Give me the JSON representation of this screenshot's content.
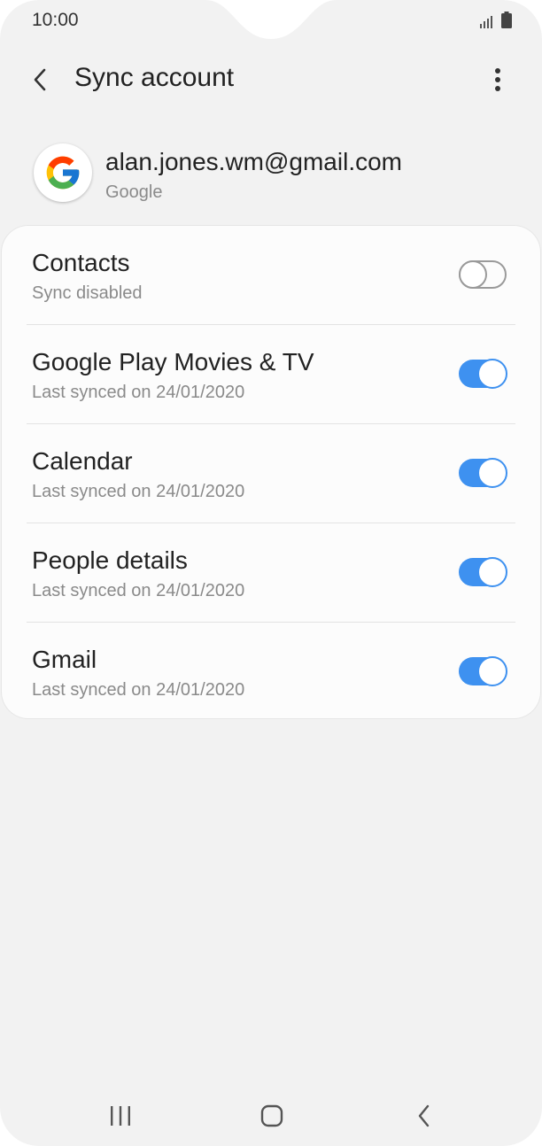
{
  "status_bar": {
    "time": "10:00"
  },
  "app_bar": {
    "title": "Sync account",
    "back_icon": "chevron-left-icon",
    "more_icon": "more-vertical-icon"
  },
  "account": {
    "email": "alan.jones.wm@gmail.com",
    "type": "Google",
    "logo_icon": "google-g-icon"
  },
  "sync_items": [
    {
      "title": "Contacts",
      "status": "Sync disabled",
      "enabled": false
    },
    {
      "title": "Google Play Movies & TV",
      "status": "Last synced on 24/01/2020",
      "enabled": true
    },
    {
      "title": "Calendar",
      "status": "Last synced on 24/01/2020",
      "enabled": true
    },
    {
      "title": "People details",
      "status": "Last synced on 24/01/2020",
      "enabled": true
    },
    {
      "title": "Gmail",
      "status": "Last synced on 24/01/2020",
      "enabled": true
    }
  ],
  "colors": {
    "background": "#f2f2f2",
    "card": "#fcfcfc",
    "toggle_on": "#3e91f0",
    "toggle_off_border": "#9a9a9a",
    "text_primary": "#222222",
    "text_secondary": "#8a8a8a"
  },
  "nav_bar": {
    "recents_icon": "recents-icon",
    "home_icon": "home-icon",
    "back_icon": "nav-back-icon"
  }
}
